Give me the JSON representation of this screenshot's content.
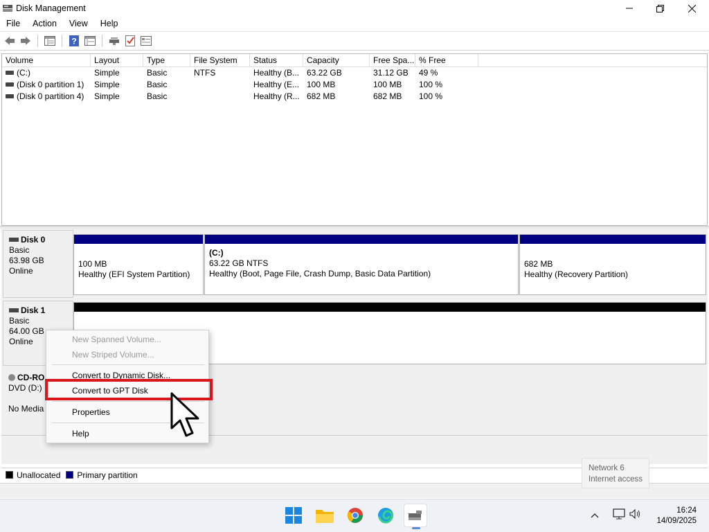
{
  "window": {
    "title": "Disk Management",
    "controls": {
      "minimize": "—",
      "maximize": "❐",
      "close": "✕"
    }
  },
  "menu": [
    "File",
    "Action",
    "View",
    "Help"
  ],
  "toolbar": {
    "icons": [
      "back-icon",
      "forward-icon",
      "show-list-icon",
      "help-icon",
      "properties-icon",
      "rescan-disks-icon",
      "check-icon",
      "console-icon"
    ]
  },
  "volume_list": {
    "columns": [
      "Volume",
      "Layout",
      "Type",
      "File System",
      "Status",
      "Capacity",
      "Free Spa...",
      "% Free"
    ],
    "rows": [
      [
        "(C:)",
        "Simple",
        "Basic",
        "NTFS",
        "Healthy (B...",
        "63.22 GB",
        "31.12 GB",
        "49 %"
      ],
      [
        "(Disk 0 partition 1)",
        "Simple",
        "Basic",
        "",
        "Healthy (E...",
        "100 MB",
        "100 MB",
        "100 %"
      ],
      [
        "(Disk 0 partition 4)",
        "Simple",
        "Basic",
        "",
        "Healthy (R...",
        "682 MB",
        "682 MB",
        "100 %"
      ]
    ]
  },
  "disks": {
    "disk0": {
      "name": "Disk 0",
      "type": "Basic",
      "size": "63.98 GB",
      "status": "Online",
      "partitions": [
        {
          "title": "",
          "size": "100 MB",
          "status": "Healthy (EFI System Partition)"
        },
        {
          "title": "(C:)",
          "size": "63.22 GB NTFS",
          "status": "Healthy (Boot, Page File, Crash Dump, Basic Data Partition)"
        },
        {
          "title": "",
          "size": "682 MB",
          "status": "Healthy (Recovery Partition)"
        }
      ]
    },
    "disk1": {
      "name": "Disk 1",
      "type": "Basic",
      "size": "64.00 GB",
      "status": "Online"
    },
    "cdrom": {
      "name": "CD-RO",
      "type": "DVD (D:)",
      "status": "No Media"
    }
  },
  "legend": {
    "unallocated": "Unallocated",
    "primary": "Primary partition",
    "unallocated_color": "#000000",
    "primary_color": "#000080"
  },
  "context_menu": {
    "new_spanned": "New Spanned Volume...",
    "new_striped": "New Striped Volume...",
    "convert_dynamic": "Convert to Dynamic Disk...",
    "convert_gpt": "Convert to GPT Disk",
    "properties": "Properties",
    "help": "Help",
    "highlight_color": "#d9161c"
  },
  "network_popup": {
    "line1": "Network 6",
    "line2": "Internet access"
  },
  "taskbar": {
    "apps": [
      "windows-start-icon",
      "file-explorer-icon",
      "chrome-icon",
      "edge-icon",
      "disk-management-icon"
    ],
    "tray": [
      "chevron-up-icon",
      "network-icon",
      "volume-icon"
    ],
    "time": "16:24",
    "date": "14/09/2025"
  }
}
